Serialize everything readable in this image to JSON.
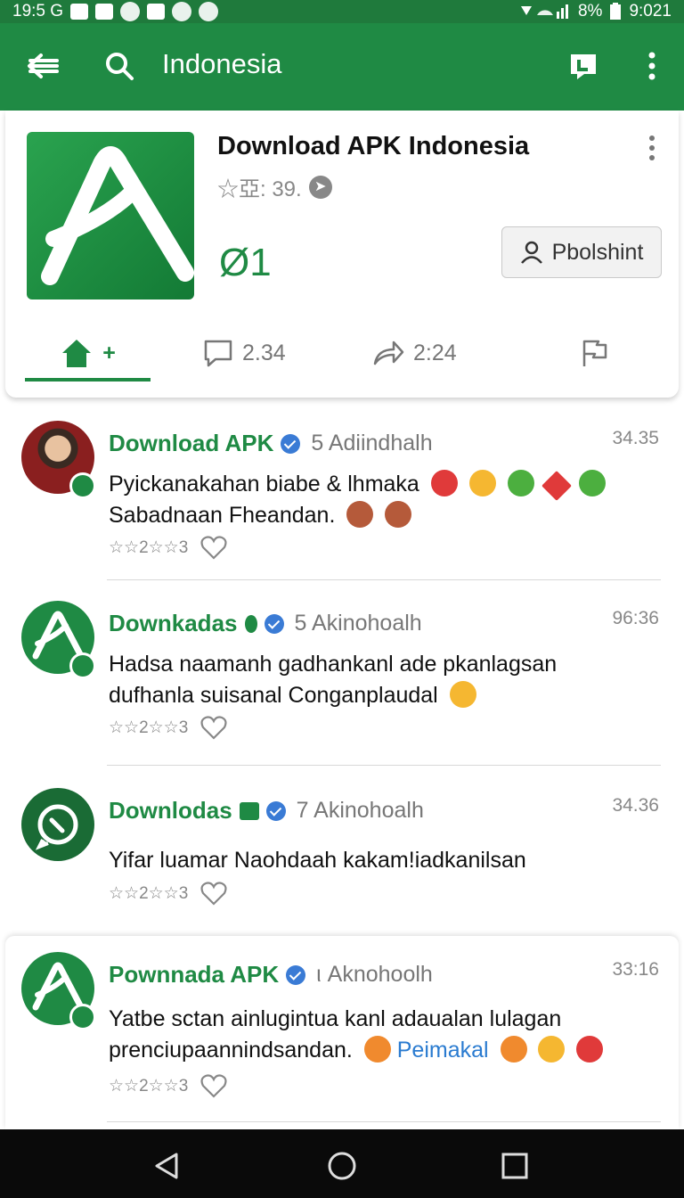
{
  "status_bar": {
    "left_text": "19:5 G",
    "battery": "8%",
    "time": "9:021"
  },
  "app_bar": {
    "back_icon": "back-arrow-icon",
    "search_icon": "search-icon",
    "title": "Indonesia",
    "tag_icon": "tag-icon",
    "more_icon": "overflow-menu-icon"
  },
  "header": {
    "app_name": "Download APK Indonesia",
    "rating": "☆亞: 39.",
    "big_number": "Ø1",
    "publish_label": "Pbolshint",
    "tabs": [
      {
        "label": "+",
        "icon": "home-icon"
      },
      {
        "label": "2.34",
        "icon": "comment-icon"
      },
      {
        "label": "2:24",
        "icon": "share-icon"
      },
      {
        "label": "",
        "icon": "flag-icon"
      }
    ]
  },
  "posts": [
    {
      "name": "Download APK",
      "meta": "5 Adiindhalh",
      "time": "34.35",
      "body_line1": "Pyickanakahan biabe & lhmaka",
      "body_line2": "Sabadnaan Fheandan.",
      "reacts": "☆☆2☆☆3"
    },
    {
      "name": "Downkadas",
      "meta": "5 Akinohoalh",
      "time": "96:36",
      "body_line1": "Hadsa naamanh gadhankanl ade pkanlagsan",
      "body_line2": "dufhanla suisanal Conganplaudal",
      "reacts": "☆☆2☆☆3"
    },
    {
      "name": "Downlodas",
      "meta": "7 Akinohoalh",
      "time": "34.36",
      "body_line1": "Yifar luamar Naohdaah kakam!iadkanilsan",
      "reacts": "☆☆2☆☆3"
    },
    {
      "name": "Pownnada APK",
      "meta": "ι Aknohoolh",
      "time": "33:16",
      "body_line1": "Yatbe sctan ainlugintua kanl adaualan lulagan",
      "body_line2": "prenciupaannindsandan.",
      "link": "Peimakal",
      "reacts": "☆☆2☆☆3"
    }
  ],
  "colors": {
    "brand_green": "#1f8a44",
    "verified_blue": "#3a7bd5"
  }
}
